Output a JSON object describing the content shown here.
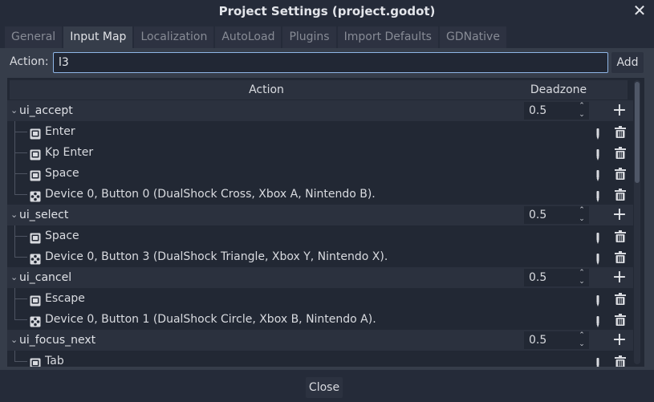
{
  "window": {
    "title": "Project Settings (project.godot)"
  },
  "tabs": [
    {
      "label": "General",
      "active": false
    },
    {
      "label": "Input Map",
      "active": true
    },
    {
      "label": "Localization",
      "active": false
    },
    {
      "label": "AutoLoad",
      "active": false
    },
    {
      "label": "Plugins",
      "active": false
    },
    {
      "label": "Import Defaults",
      "active": false
    },
    {
      "label": "GDNative",
      "active": false
    }
  ],
  "action_bar": {
    "label": "Action:",
    "input_value": "l3",
    "add_label": "Add"
  },
  "tree": {
    "header": {
      "action": "Action",
      "deadzone": "Deadzone"
    },
    "groups": [
      {
        "name": "ui_accept",
        "deadzone": "0.5",
        "events": [
          {
            "label": "Enter",
            "type": "key"
          },
          {
            "label": "Kp Enter",
            "type": "key"
          },
          {
            "label": "Space",
            "type": "key"
          },
          {
            "label": "Device 0, Button 0 (DualShock Cross, Xbox A, Nintendo B).",
            "type": "joypad"
          }
        ]
      },
      {
        "name": "ui_select",
        "deadzone": "0.5",
        "events": [
          {
            "label": "Space",
            "type": "key"
          },
          {
            "label": "Device 0, Button 3 (DualShock Triangle, Xbox Y, Nintendo X).",
            "type": "joypad"
          }
        ]
      },
      {
        "name": "ui_cancel",
        "deadzone": "0.5",
        "events": [
          {
            "label": "Escape",
            "type": "key"
          },
          {
            "label": "Device 0, Button 1 (DualShock Circle, Xbox B, Nintendo A).",
            "type": "joypad"
          }
        ]
      },
      {
        "name": "ui_focus_next",
        "deadzone": "0.5",
        "events": [
          {
            "label": "Tab",
            "type": "key"
          }
        ]
      }
    ]
  },
  "footer": {
    "close_label": "Close"
  },
  "colors": {
    "background": "#252b39",
    "panel": "#363d4a",
    "tree_bg": "#222834",
    "accent": "#8fb6e6"
  }
}
